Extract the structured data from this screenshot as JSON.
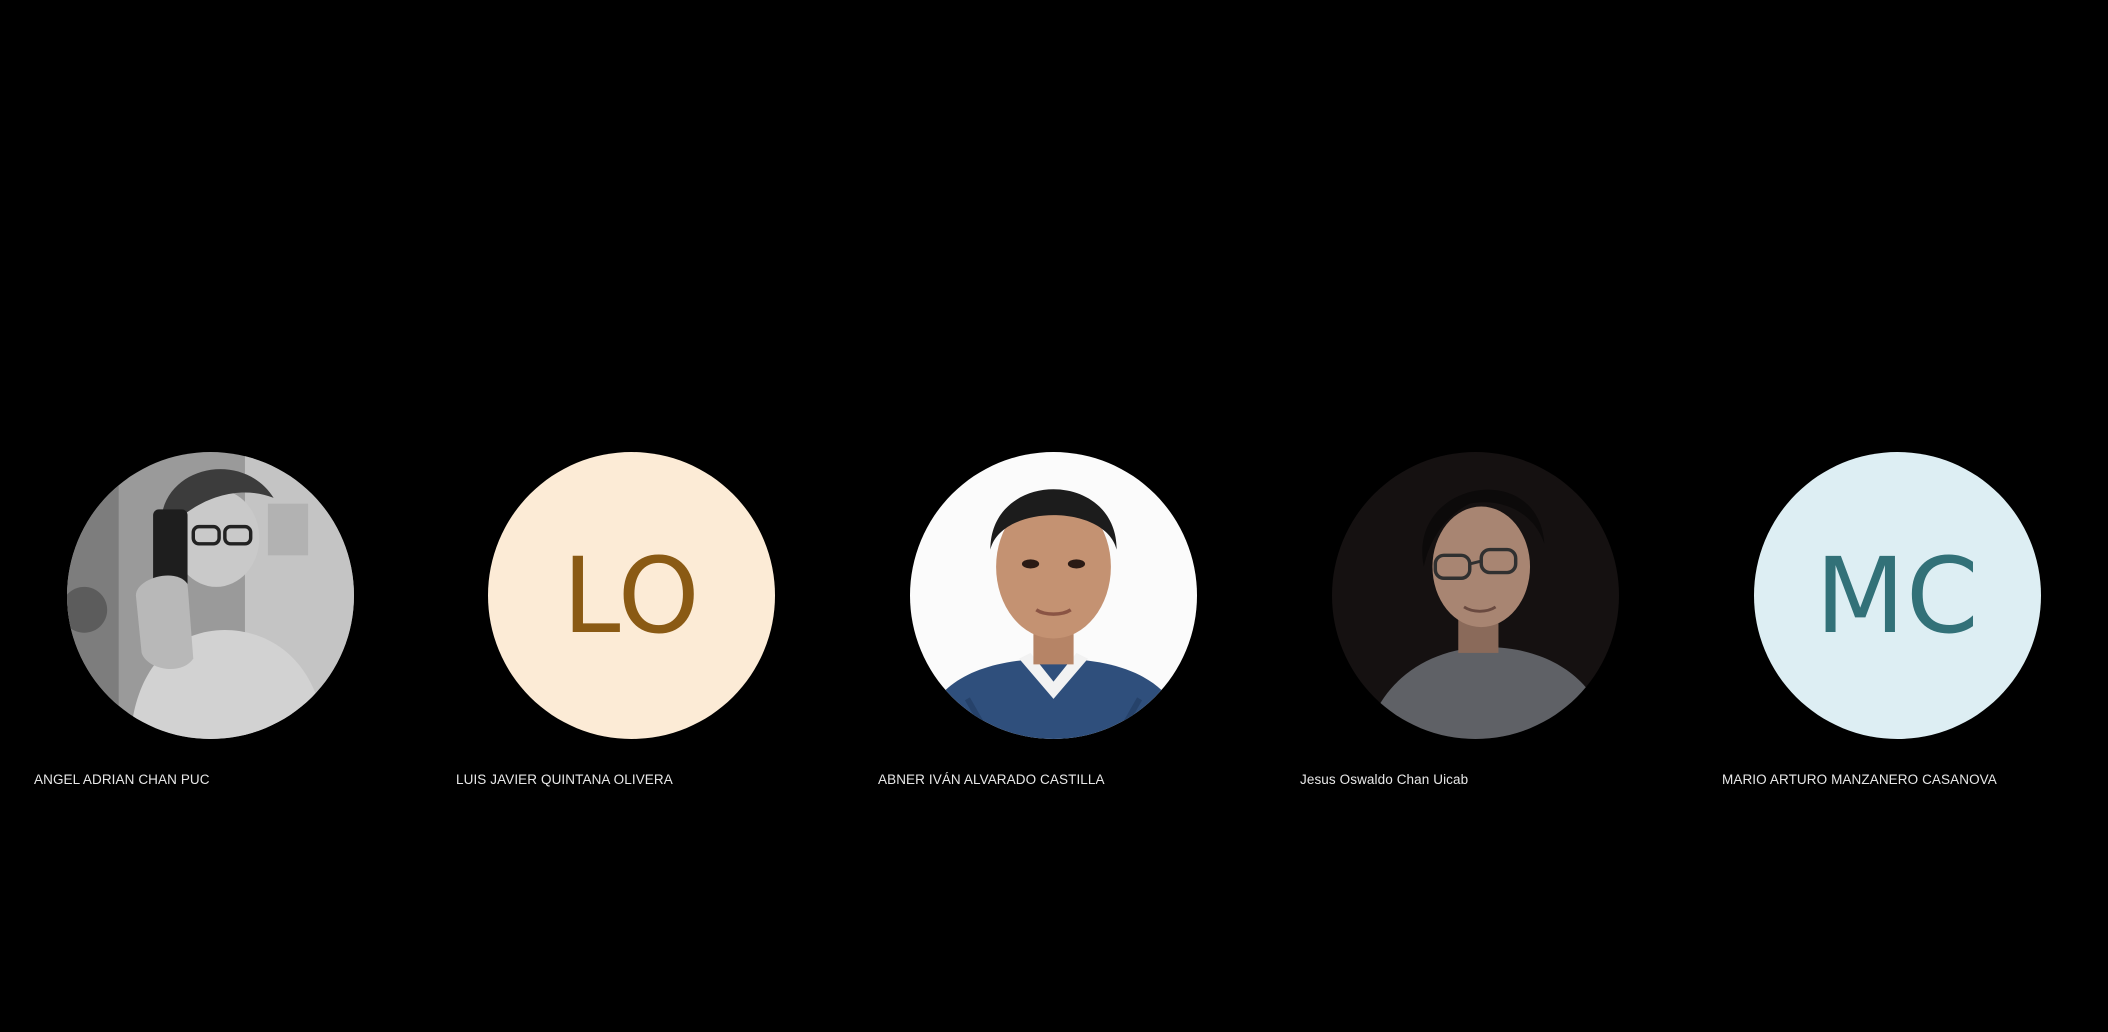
{
  "participants": [
    {
      "name": "ANGEL ADRIAN CHAN PUC",
      "avatar_type": "photo",
      "avatar_icon": "grayscale-selfie-photo"
    },
    {
      "name": "LUIS JAVIER QUINTANA OLIVERA",
      "avatar_type": "initials",
      "initials": "LO",
      "bg_color": "#FCEBD6",
      "fg_color": "#8A5A14"
    },
    {
      "name": "ABNER IVÁN ALVARADO CASTILLA",
      "avatar_type": "photo",
      "avatar_icon": "portrait-photo-white-background"
    },
    {
      "name": "Jesus Oswaldo Chan Uicab",
      "avatar_type": "photo",
      "avatar_icon": "dark-portrait-photo-glasses"
    },
    {
      "name": "MARIO ARTURO MANZANERO CASANOVA",
      "avatar_type": "initials",
      "initials": "MC",
      "bg_color": "#DDEEF3",
      "fg_color": "#327178"
    }
  ],
  "colors": {
    "background": "#000000",
    "name_text": "#E8E8E8"
  }
}
